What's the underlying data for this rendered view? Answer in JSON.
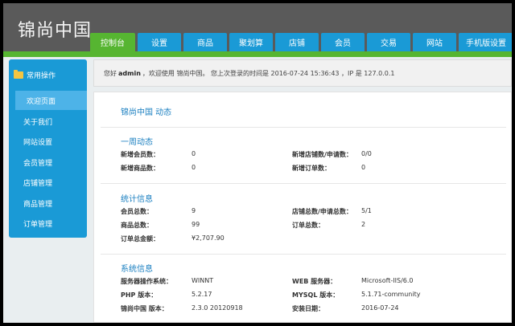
{
  "brand": {
    "logo": "锦尚中国"
  },
  "nav": {
    "tabs": [
      {
        "label": "控制台",
        "active": true
      },
      {
        "label": "设置"
      },
      {
        "label": "商品"
      },
      {
        "label": "聚划算"
      },
      {
        "label": "店铺"
      },
      {
        "label": "会员"
      },
      {
        "label": "交易"
      },
      {
        "label": "网站"
      },
      {
        "label": "手机版设置"
      }
    ]
  },
  "sidebar": {
    "heading": "常用操作",
    "items": [
      {
        "label": "欢迎页面",
        "active": true
      },
      {
        "label": "关于我们"
      },
      {
        "label": "网站设置"
      },
      {
        "label": "会员管理"
      },
      {
        "label": "店铺管理"
      },
      {
        "label": "商品管理"
      },
      {
        "label": "订单管理"
      }
    ]
  },
  "welcome": {
    "prefix": "您好",
    "user": "admin",
    "middle": "，欢迎使用 锦尚中国。 您上次登录的时间是 2016-07-24 15:36:43 ，IP 是 127.0.0.1"
  },
  "main": {
    "title": "锦尚中国 动态",
    "week": {
      "title": "一周动态",
      "rows": [
        {
          "label1": "新增会员数：",
          "value1": "0",
          "label2": "新增店铺数/申请数：",
          "value2": "0/0"
        },
        {
          "label1": "新增商品数：",
          "value1": "0",
          "label2": "新增订单数：",
          "value2": "0"
        }
      ]
    },
    "stats": {
      "title": "统计信息",
      "rows": [
        {
          "label1": "会员总数：",
          "value1": "9",
          "label2": "店铺总数/申请总数：",
          "value2": "5/1"
        },
        {
          "label1": "商品总数：",
          "value1": "99",
          "label2": "订单总数：",
          "value2": "2"
        },
        {
          "label1": "订单总金额：",
          "value1": "¥2,707.90"
        }
      ]
    },
    "system": {
      "title": "系统信息",
      "rows": [
        {
          "label1": "服务器操作系统：",
          "value1": "WINNT",
          "label2": "WEB 服务器：",
          "value2": "Microsoft-IIS/6.0"
        },
        {
          "label1": "PHP 版本：",
          "value1": "5.2.17",
          "label2": "MYSQL 版本：",
          "value2": "5.1.71-community"
        },
        {
          "label1": "锦尚中国 版本：",
          "value1": "2.3.0 20120918",
          "label2": "安装日期：",
          "value2": "2016-07-24"
        }
      ]
    }
  },
  "colors": {
    "header": "#5a5a5a",
    "accent_green": "#56b531",
    "accent_blue": "#1a9ad6",
    "sidebar_active": "#4db3e8",
    "link_blue": "#1a7fc0"
  }
}
